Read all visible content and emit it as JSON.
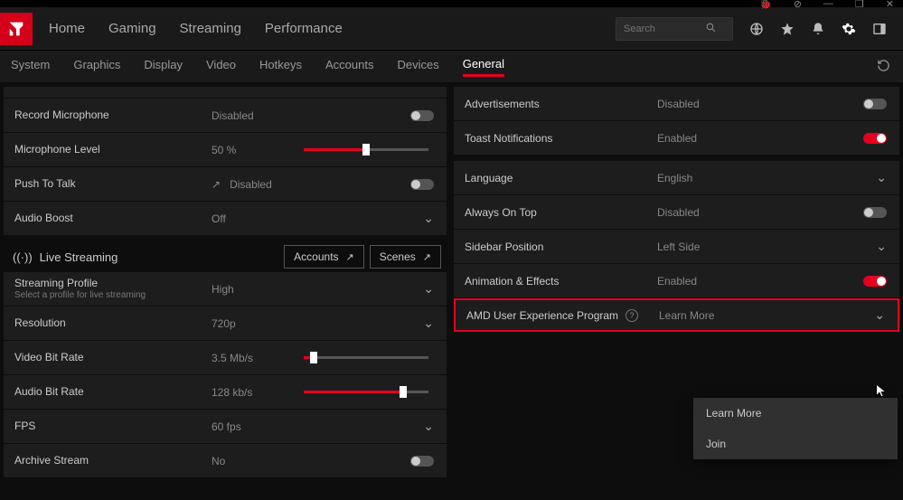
{
  "titlebar": {
    "debug": "🐞",
    "help": "?",
    "min": "—",
    "max": "❐",
    "close": "✕"
  },
  "mainnav": {
    "home": "Home",
    "gaming": "Gaming",
    "streaming": "Streaming",
    "performance": "Performance"
  },
  "search": {
    "placeholder": "Search"
  },
  "subnav": {
    "system": "System",
    "graphics": "Graphics",
    "display": "Display",
    "video": "Video",
    "hotkeys": "Hotkeys",
    "accounts": "Accounts",
    "devices": "Devices",
    "general": "General"
  },
  "left": {
    "record_mic": {
      "label": "Record Microphone",
      "value": "Disabled"
    },
    "mic_level": {
      "label": "Microphone Level",
      "value": "50 %"
    },
    "ptt": {
      "label": "Push To Talk",
      "value": "Disabled"
    },
    "audio_boost": {
      "label": "Audio Boost",
      "value": "Off"
    },
    "live_header": "Live Streaming",
    "btn_accounts": "Accounts",
    "btn_scenes": "Scenes",
    "profile": {
      "label": "Streaming Profile",
      "sub": "Select a profile for live streaming",
      "value": "High"
    },
    "resolution": {
      "label": "Resolution",
      "value": "720p"
    },
    "vbr": {
      "label": "Video Bit Rate",
      "value": "3.5 Mb/s"
    },
    "abr": {
      "label": "Audio Bit Rate",
      "value": "128 kb/s"
    },
    "fps": {
      "label": "FPS",
      "value": "60 fps"
    },
    "archive": {
      "label": "Archive Stream",
      "value": "No"
    }
  },
  "right": {
    "ads": {
      "label": "Advertisements",
      "value": "Disabled"
    },
    "toast": {
      "label": "Toast Notifications",
      "value": "Enabled"
    },
    "lang": {
      "label": "Language",
      "value": "English"
    },
    "ontop": {
      "label": "Always On Top",
      "value": "Disabled"
    },
    "sidebar": {
      "label": "Sidebar Position",
      "value": "Left Side"
    },
    "anim": {
      "label": "Animation & Effects",
      "value": "Enabled"
    },
    "uep": {
      "label": "AMD User Experience Program",
      "value": "Learn More"
    }
  },
  "dropdown": {
    "learn": "Learn More",
    "join": "Join"
  },
  "chart_data": null
}
